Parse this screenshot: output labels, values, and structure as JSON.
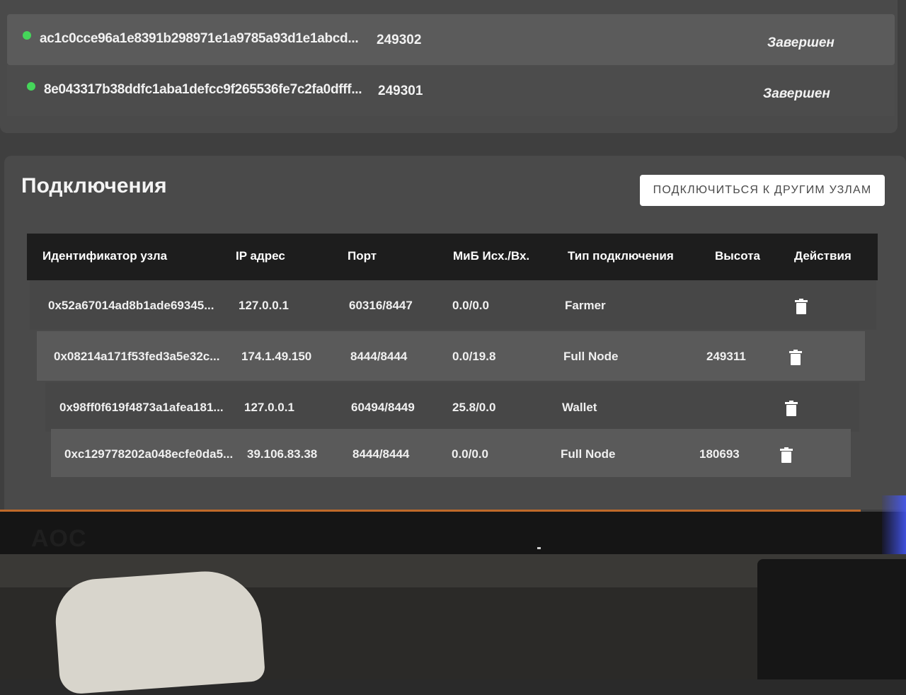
{
  "blocks": [
    {
      "hash": "ac1c0cce96a1e8391b298971e1a9785a93d1e1abcd...",
      "height": "249302",
      "state": "Завершен",
      "status_color": "#45d65a"
    },
    {
      "hash": "8e043317b38ddfc1aba1defcc9f265536fe7c2fa0dfff...",
      "height": "249301",
      "state": "Завершен",
      "status_color": "#45d65a"
    }
  ],
  "connections": {
    "title": "Подключения",
    "connect_button": "ПОДКЛЮЧИТЬСЯ К ДРУГИМ УЗЛАМ",
    "columns": [
      "Идентификатор узла",
      "IP адрес",
      "Порт",
      "МиБ Исх./Вх.",
      "Тип подключения",
      "Высота",
      "Действия"
    ],
    "rows": [
      {
        "node_id": "0x52a67014ad8b1ade69345...",
        "ip": "127.0.0.1",
        "port": "60316/8447",
        "mib": "0.0/0.0",
        "type": "Farmer",
        "height": "",
        "action_icon": "trash-icon"
      },
      {
        "node_id": "0x08214a171f53fed3a5e32c...",
        "ip": "174.1.49.150",
        "port": "8444/8444",
        "mib": "0.0/19.8",
        "type": "Full Node",
        "height": "249311",
        "action_icon": "trash-icon"
      },
      {
        "node_id": "0x98ff0f619f4873a1afea181...",
        "ip": "127.0.0.1",
        "port": "60494/8449",
        "mib": "25.8/0.0",
        "type": "Wallet",
        "height": "",
        "action_icon": "trash-icon"
      },
      {
        "node_id": "0xc129778202a048ecfe0da5...",
        "ip": "39.106.83.38",
        "port": "8444/8444",
        "mib": "0.0/0.0",
        "type": "Full Node",
        "height": "180693",
        "action_icon": "trash-icon"
      }
    ]
  },
  "monitor": {
    "brand": "AOC"
  }
}
